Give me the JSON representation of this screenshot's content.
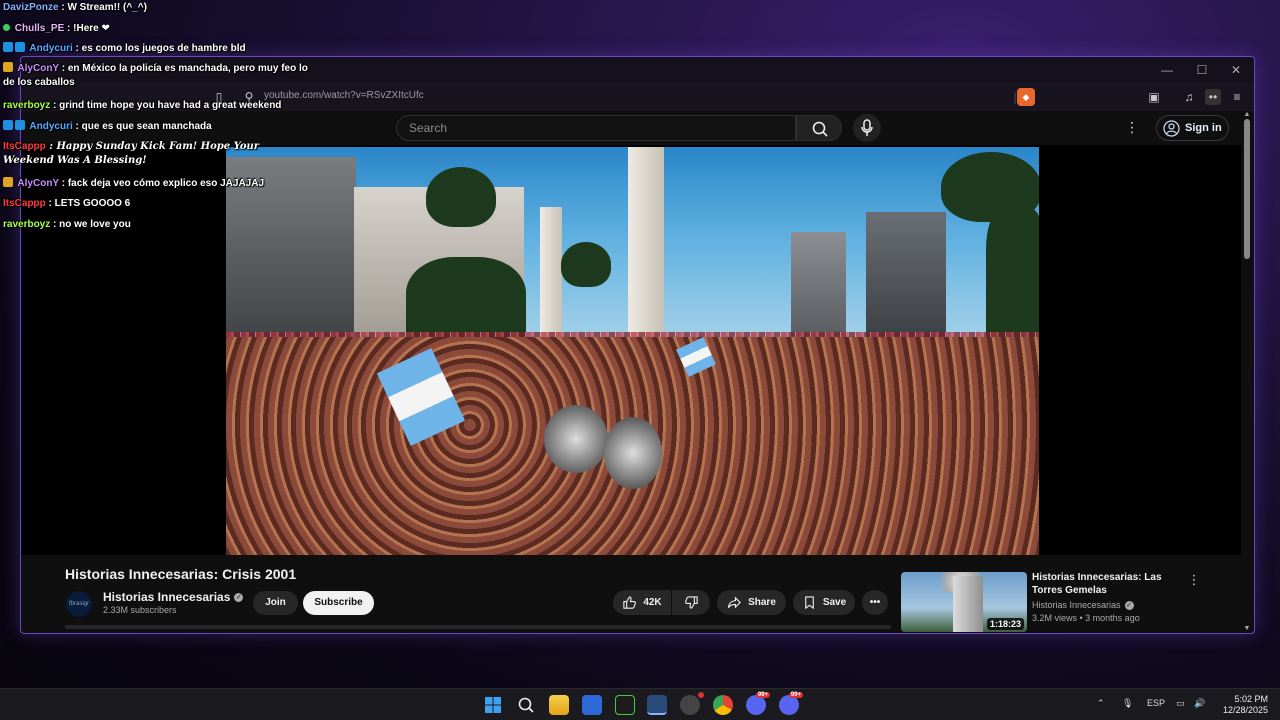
{
  "browser": {
    "url": "youtube.com/watch?v=RSvZXItcUfc"
  },
  "youtube": {
    "search_placeholder": "Search",
    "sign_in": "Sign in"
  },
  "video": {
    "title": "Historias Innecesarias: Crisis 2001",
    "channel": "Historias Innecesarias",
    "channel_avatar_text": "fbrasigr",
    "subscribers": "2.33M subscribers",
    "join": "Join",
    "subscribe": "Subscribe",
    "likes": "42K",
    "share": "Share",
    "save": "Save"
  },
  "recommended": {
    "title": "Historias Innecesarias: Las Torres Gemelas",
    "channel": "Historias Innecesarias",
    "meta": "3.2M views • 3 months ago",
    "duration": "1:18:23"
  },
  "chat": [
    {
      "user": "DavizPonze",
      "user_color": "#7fb3ff",
      "msg": "W Stream!! (^_^)"
    },
    {
      "user": "Chulls_PE",
      "user_color": "#e6b3ff",
      "msg": "!Here ❤"
    },
    {
      "user": "Andycuri",
      "user_color": "#5aa7ff",
      "msg": "es como los juegos de hambre bld"
    },
    {
      "user": "AlyConY",
      "user_color": "#c98bff",
      "msg": "en México la policía es manchada, pero muy feo lo de los caballos"
    },
    {
      "user": "raverboyz",
      "user_color": "#a6ff4d",
      "msg": "grind time hope you have had a great weekend"
    },
    {
      "user": "Andycuri",
      "user_color": "#5aa7ff",
      "msg": "que es que sean manchada"
    },
    {
      "user": "ItsCappp",
      "user_color": "#ff3b3b",
      "msg": "Happy Sunday Kick Fam! Hope Your Weekend Was A Blessing!"
    },
    {
      "user": "AlyConY",
      "user_color": "#c98bff",
      "msg": "fack deja veo cómo explico eso JAJAJAJ"
    },
    {
      "user": "ItsCappp",
      "user_color": "#ff3b3b",
      "msg": "LETS GOOOO 6"
    },
    {
      "user": "raverboyz",
      "user_color": "#a6ff4d",
      "msg": "no we love you"
    }
  ],
  "taskbar": {
    "lang": "ESP",
    "time": "5:02 PM",
    "date": "12/28/2025",
    "badge_a": "99+",
    "badge_b": "99+"
  },
  "colors": {
    "accent": "#6b47c8",
    "yt_bg": "#0f0f0f"
  }
}
